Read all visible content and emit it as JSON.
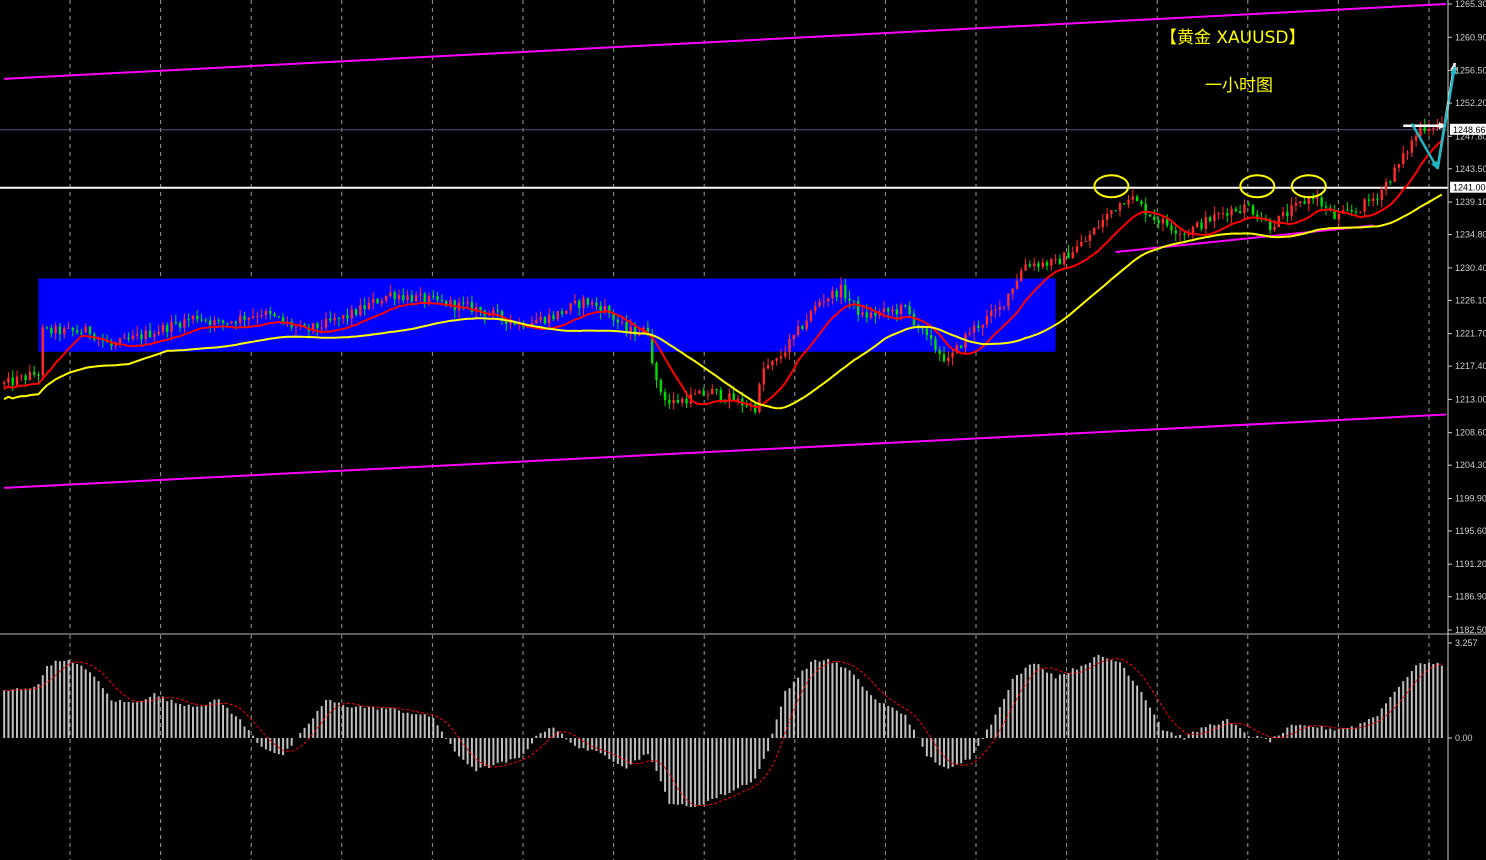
{
  "chart_data": [
    {
      "type": "candlestick",
      "title": "【黄金 XAUUSD】",
      "subtitle": "一小时图",
      "ylim": [
        1182.5,
        1265.3
      ],
      "y_ticks": [
        {
          "v": 1265.3,
          "label": "1265.30"
        },
        {
          "v": 1260.9,
          "label": "1260.90"
        },
        {
          "v": 1256.5,
          "label": "1256.50"
        },
        {
          "v": 1252.2,
          "label": "1252.20"
        },
        {
          "v": 1247.8,
          "label": "1247.80"
        },
        {
          "v": 1243.5,
          "label": "1243.50"
        },
        {
          "v": 1239.1,
          "label": "1239.10"
        },
        {
          "v": 1234.8,
          "label": "1234.80"
        },
        {
          "v": 1230.4,
          "label": "1230.40"
        },
        {
          "v": 1226.1,
          "label": "1226.10"
        },
        {
          "v": 1221.7,
          "label": "1221.70"
        },
        {
          "v": 1217.4,
          "label": "1217.40"
        },
        {
          "v": 1213.0,
          "label": "1213.00"
        },
        {
          "v": 1208.6,
          "label": "1208.60"
        },
        {
          "v": 1204.3,
          "label": "1204.30"
        },
        {
          "v": 1199.9,
          "label": "1199.90"
        },
        {
          "v": 1195.6,
          "label": "1195.60"
        },
        {
          "v": 1191.2,
          "label": "1191.20"
        },
        {
          "v": 1186.9,
          "label": "1186.90"
        },
        {
          "v": 1182.5,
          "label": "1182.50"
        }
      ],
      "price_markers": [
        {
          "v": 1248.66,
          "label": "1248.66"
        },
        {
          "v": 1241.0,
          "label": "1241.00"
        }
      ],
      "candle_count": 336,
      "price_path": [
        [
          0,
          1215.0
        ],
        [
          8,
          1216.5
        ],
        [
          9,
          1222.0
        ],
        [
          20,
          1222.0
        ],
        [
          25,
          1220.0
        ],
        [
          35,
          1222.0
        ],
        [
          45,
          1224.0
        ],
        [
          50,
          1223.0
        ],
        [
          60,
          1224.5
        ],
        [
          70,
          1222.0
        ],
        [
          80,
          1224.0
        ],
        [
          90,
          1227.0
        ],
        [
          100,
          1226.0
        ],
        [
          110,
          1225.0
        ],
        [
          120,
          1223.0
        ],
        [
          128,
          1224.0
        ],
        [
          135,
          1226.0
        ],
        [
          140,
          1225.0
        ],
        [
          145,
          1222.0
        ],
        [
          150,
          1222.0
        ],
        [
          152,
          1215.0
        ],
        [
          155,
          1212.5
        ],
        [
          165,
          1214.0
        ],
        [
          172,
          1212.5
        ],
        [
          175,
          1212.0
        ],
        [
          177,
          1217.0
        ],
        [
          180,
          1218.0
        ],
        [
          190,
          1226.0
        ],
        [
          195,
          1227.5
        ],
        [
          200,
          1224.0
        ],
        [
          210,
          1225.0
        ],
        [
          215,
          1221.0
        ],
        [
          220,
          1218.0
        ],
        [
          225,
          1222.0
        ],
        [
          232,
          1225.0
        ],
        [
          238,
          1231.0
        ],
        [
          245,
          1231.0
        ],
        [
          252,
          1234.0
        ],
        [
          258,
          1238.0
        ],
        [
          262,
          1240.0
        ],
        [
          268,
          1237.0
        ],
        [
          275,
          1235.0
        ],
        [
          285,
          1238.0
        ],
        [
          290,
          1238.5
        ],
        [
          295,
          1236.0
        ],
        [
          300,
          1238.0
        ],
        [
          305,
          1240.0
        ],
        [
          310,
          1237.0
        ],
        [
          315,
          1238.0
        ],
        [
          320,
          1240.0
        ],
        [
          325,
          1244.0
        ],
        [
          330,
          1249.0
        ],
        [
          335,
          1249.5
        ]
      ],
      "series": [
        {
          "name": "",
          "kind": "moving-average",
          "color": "#ff0000",
          "period": 10
        },
        {
          "name": "",
          "kind": "moving-average",
          "color": "#ffff00",
          "period": 30
        }
      ],
      "channel_lines": [
        {
          "color": "#ff00ff",
          "from": {
            "i": 0,
            "v": 1255.4
          },
          "to": {
            "i": 336,
            "v": 1265.3
          }
        },
        {
          "color": "#ff00ff",
          "from": {
            "i": 0,
            "v": 1201.3
          },
          "to": {
            "i": 336,
            "v": 1211.0
          }
        },
        {
          "color": "#ff00ff",
          "from": {
            "i": 259,
            "v": 1232.5
          },
          "to": {
            "i": 319,
            "v": 1236.0
          }
        }
      ],
      "horizontal_lines": [
        {
          "color": "#ffffff",
          "v": 1241.0
        },
        {
          "color": "#55558a",
          "v": 1248.66
        }
      ],
      "range_box": {
        "color": "#0000ff",
        "from_i": 8,
        "to_i": 245,
        "top": 1229.0,
        "bottom": 1219.3
      },
      "highlight_circles": [
        {
          "i": 258,
          "v": 1241.2
        },
        {
          "i": 292,
          "v": 1241.2
        },
        {
          "i": 304,
          "v": 1241.2
        }
      ],
      "arrows": [
        {
          "color": "#ffffff",
          "from": {
            "i": 334,
            "v": 1243.5
          },
          "to": {
            "i": 338,
            "v": 1257.5
          }
        },
        {
          "color": "#ffffff",
          "from": {
            "i": 326,
            "v": 1249.2
          },
          "to": {
            "i": 336,
            "v": 1249.2
          }
        },
        {
          "color": "#1fb7c4",
          "from": {
            "i": 328,
            "v": 1249.5
          },
          "to": {
            "i": 334,
            "v": 1243.5
          }
        },
        {
          "color": "#1fb7c4",
          "from": {
            "i": 334,
            "v": 1243.5
          },
          "to": {
            "i": 338,
            "v": 1257.0
          }
        }
      ]
    },
    {
      "type": "bar",
      "title": "",
      "ylim": [
        -1.0,
        3.257
      ],
      "y_ticks": [
        {
          "v": 3.257,
          "label": "3.257"
        },
        {
          "v": 0.0,
          "label": "0.00"
        }
      ],
      "series": [
        {
          "name": "",
          "kind": "histogram",
          "color": "#c0c0c0"
        },
        {
          "name": "",
          "kind": "signal",
          "color": "#ff0000"
        }
      ],
      "values_path": [
        [
          0,
          1.6
        ],
        [
          8,
          1.8
        ],
        [
          10,
          2.5
        ],
        [
          14,
          2.7
        ],
        [
          20,
          2.3
        ],
        [
          25,
          1.3
        ],
        [
          30,
          1.2
        ],
        [
          35,
          1.5
        ],
        [
          40,
          1.2
        ],
        [
          45,
          1.1
        ],
        [
          50,
          1.3
        ],
        [
          55,
          0.6
        ],
        [
          60,
          -0.3
        ],
        [
          65,
          -0.6
        ],
        [
          70,
          0.3
        ],
        [
          75,
          1.3
        ],
        [
          80,
          1.1
        ],
        [
          90,
          1.0
        ],
        [
          100,
          0.7
        ],
        [
          105,
          -0.5
        ],
        [
          110,
          -1.1
        ],
        [
          120,
          -0.7
        ],
        [
          125,
          0.2
        ],
        [
          128,
          0.4
        ],
        [
          132,
          -0.2
        ],
        [
          140,
          -0.6
        ],
        [
          145,
          -1.0
        ],
        [
          150,
          -0.5
        ],
        [
          155,
          -2.2
        ],
        [
          160,
          -2.4
        ],
        [
          170,
          -1.8
        ],
        [
          175,
          -1.4
        ],
        [
          178,
          -0.4
        ],
        [
          182,
          1.6
        ],
        [
          188,
          2.6
        ],
        [
          192,
          2.7
        ],
        [
          197,
          2.3
        ],
        [
          203,
          1.3
        ],
        [
          210,
          0.8
        ],
        [
          215,
          -0.6
        ],
        [
          220,
          -1.1
        ],
        [
          225,
          -0.7
        ],
        [
          230,
          0.5
        ],
        [
          235,
          2.0
        ],
        [
          240,
          2.6
        ],
        [
          245,
          2.1
        ],
        [
          250,
          2.4
        ],
        [
          255,
          2.8
        ],
        [
          260,
          2.6
        ],
        [
          265,
          1.6
        ],
        [
          270,
          0.3
        ],
        [
          275,
          0.0
        ],
        [
          280,
          0.4
        ],
        [
          285,
          0.6
        ],
        [
          290,
          0.1
        ],
        [
          295,
          -0.1
        ],
        [
          300,
          0.4
        ],
        [
          305,
          0.4
        ],
        [
          310,
          0.3
        ],
        [
          315,
          0.4
        ],
        [
          320,
          0.8
        ],
        [
          325,
          1.8
        ],
        [
          330,
          2.6
        ],
        [
          335,
          2.5
        ]
      ]
    }
  ]
}
